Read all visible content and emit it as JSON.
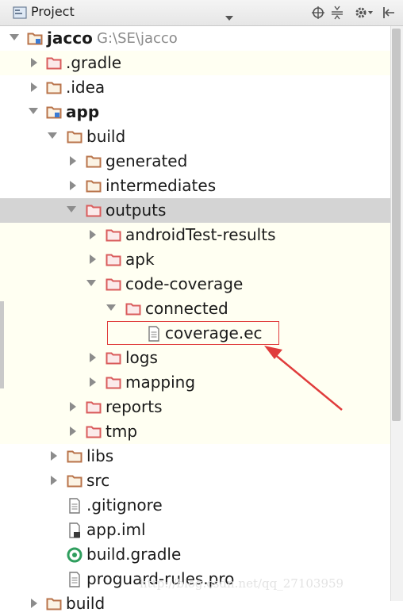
{
  "panel": {
    "title": "Project",
    "toolbar_buttons": [
      "scroll-from-source-icon",
      "collapse-all-icon",
      "settings-icon",
      "hide-panel-icon"
    ]
  },
  "tree": {
    "root": {
      "label": "jacco",
      "path": "G:\\SE\\jacco"
    },
    "gradle": ".gradle",
    "idea": ".idea",
    "app": "app",
    "build": "build",
    "generated": "generated",
    "intermediates": "intermediates",
    "outputs": "outputs",
    "android_test_results": "androidTest-results",
    "apk": "apk",
    "code_coverage": "code-coverage",
    "connected": "connected",
    "coverage_ec": "coverage.ec",
    "logs": "logs",
    "mapping": "mapping",
    "reports": "reports",
    "tmp": "tmp",
    "libs": "libs",
    "src": "src",
    "gitignore": ".gitignore",
    "app_iml": "app.iml",
    "build_gradle": "build.gradle",
    "proguard": "proguard-rules.pro",
    "root_build_partial": "build"
  },
  "watermark": "http://blog.csdn.net/qq_27103959",
  "colors": {
    "folder_outline": "#b8734a",
    "excluded_folder": "#d95b5b",
    "highlight_band": "#fffff2",
    "selection": "#d4d4d4",
    "annotation": "#e03c3c"
  }
}
